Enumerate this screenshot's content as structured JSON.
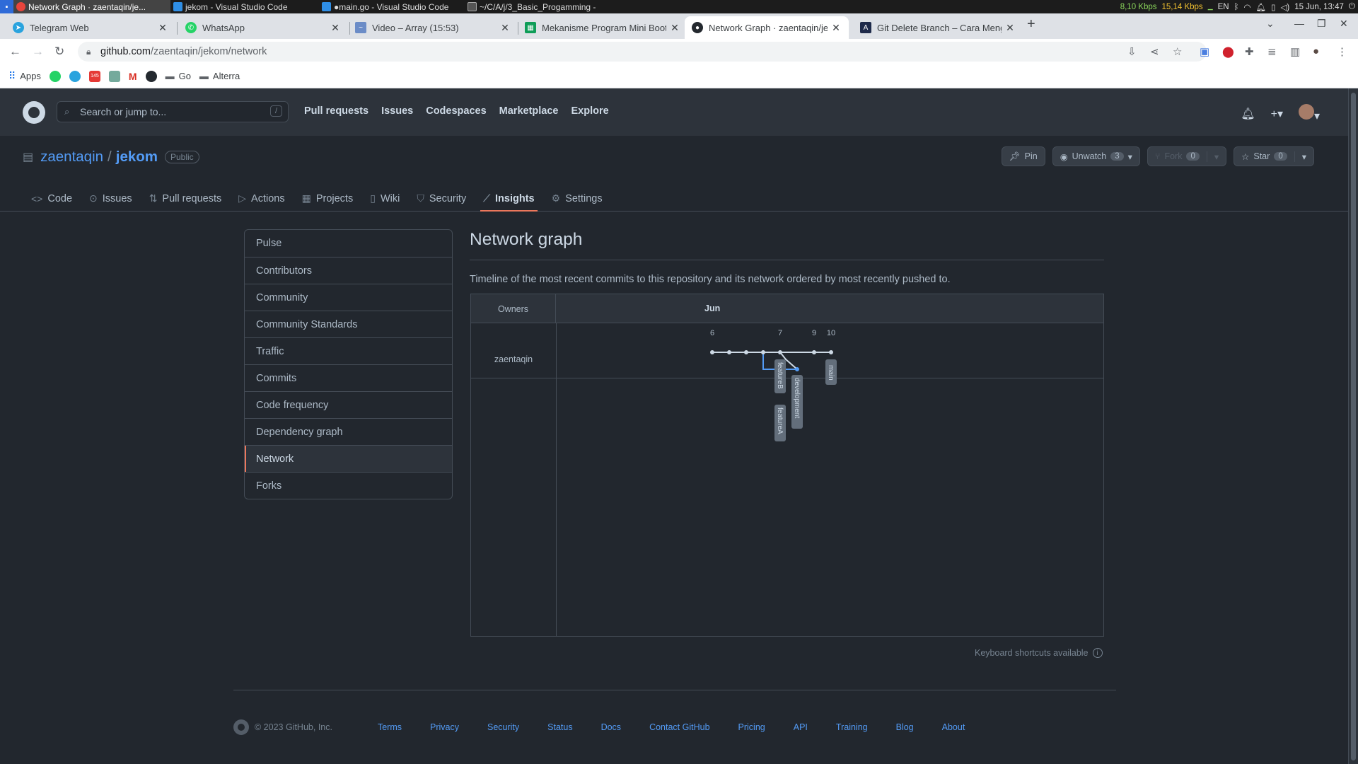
{
  "taskbar": {
    "tasks": [
      {
        "label": "Network Graph · zaentaqin/je...",
        "active": true
      },
      {
        "label": "jekom - Visual Studio Code",
        "active": false
      },
      {
        "label": "●main.go - Visual Studio Code",
        "active": false
      },
      {
        "label": "~/C/A/j/3_Basic_Progamming -",
        "active": false
      }
    ],
    "net_down": "8,10 Kbps",
    "net_up": "15,14 Kbps",
    "lang": "EN",
    "datetime": "15 Jun, 13:47"
  },
  "browser": {
    "tabs": [
      {
        "title": "Telegram Web",
        "icon": "telegram-icon",
        "color": "#2aa3de"
      },
      {
        "title": "WhatsApp",
        "icon": "whatsapp-icon",
        "color": "#25d366"
      },
      {
        "title": "Video – Array (15:53)",
        "icon": "video-icon",
        "color": "#6b8cc7"
      },
      {
        "title": "Mekanisme Program Mini Boot",
        "icon": "sheets-icon",
        "color": "#0f9d58"
      },
      {
        "title": "Network Graph · zaentaqin/jek",
        "icon": "github-icon",
        "color": "#24292f",
        "active": true
      },
      {
        "title": "Git Delete Branch – Cara Meng",
        "icon": "site-icon",
        "color": "#1e2a4a"
      }
    ],
    "url_host": "github.com",
    "url_path": "/zaentaqin/jekom/network",
    "bookmarks": [
      {
        "label": "Apps",
        "icon": "apps-grid-icon"
      },
      {
        "label": "",
        "icon": "whatsapp-icon"
      },
      {
        "label": "",
        "icon": "telegram-icon"
      },
      {
        "label": "",
        "icon": "youtube-icon",
        "badge": "145"
      },
      {
        "label": "",
        "icon": "chatgpt-icon"
      },
      {
        "label": "",
        "icon": "gmail-icon"
      },
      {
        "label": "",
        "icon": "github-icon"
      },
      {
        "label": "Go",
        "icon": "folder-icon"
      },
      {
        "label": "Alterra",
        "icon": "folder-icon"
      }
    ]
  },
  "gh": {
    "search_placeholder": "Search or jump to...",
    "search_key": "/",
    "nav": [
      "Pull requests",
      "Issues",
      "Codespaces",
      "Marketplace",
      "Explore"
    ],
    "owner": "zaentaqin",
    "sep": "/",
    "repo": "jekom",
    "visibility": "Public",
    "pin": "Pin",
    "unwatch": "Unwatch",
    "unwatch_count": "3",
    "fork": "Fork",
    "fork_count": "0",
    "star": "Star",
    "star_count": "0",
    "tabs": [
      {
        "label": "Code",
        "icon": "code-icon"
      },
      {
        "label": "Issues",
        "icon": "issue-icon"
      },
      {
        "label": "Pull requests",
        "icon": "pull-request-icon"
      },
      {
        "label": "Actions",
        "icon": "play-icon"
      },
      {
        "label": "Projects",
        "icon": "table-icon"
      },
      {
        "label": "Wiki",
        "icon": "book-icon"
      },
      {
        "label": "Security",
        "icon": "shield-icon"
      },
      {
        "label": "Insights",
        "icon": "graph-icon",
        "active": true
      },
      {
        "label": "Settings",
        "icon": "gear-icon"
      }
    ]
  },
  "sidebar": {
    "items": [
      "Pulse",
      "Contributors",
      "Community",
      "Community Standards",
      "Traffic",
      "Commits",
      "Code frequency",
      "Dependency graph",
      "Network",
      "Forks"
    ],
    "selected": "Network"
  },
  "main": {
    "title": "Network graph",
    "description": "Timeline of the most recent commits to this repository and its network ordered by most recently pushed to.",
    "owners_header": "Owners",
    "month": "Jun",
    "owner": "zaentaqin",
    "keyboard_hint": "Keyboard shortcuts available"
  },
  "chart_data": {
    "type": "network",
    "days": [
      "6",
      "7",
      "9",
      "10"
    ],
    "branches": [
      "featureB",
      "featureA",
      "development",
      "main"
    ],
    "main_line_color": "#cdd9e5",
    "branch_line_color": "#539bf5"
  },
  "footer": {
    "copyright": "© 2023 GitHub, Inc.",
    "links": [
      "Terms",
      "Privacy",
      "Security",
      "Status",
      "Docs",
      "Contact GitHub",
      "Pricing",
      "API",
      "Training",
      "Blog",
      "About"
    ]
  }
}
